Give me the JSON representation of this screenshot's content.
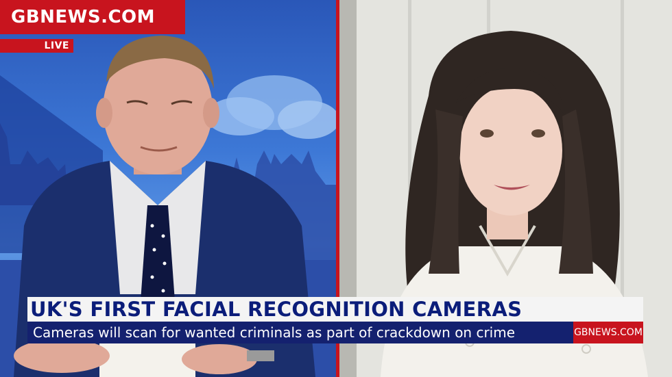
{
  "brand": {
    "name": "GBNEWS.COM",
    "color": "#c8141e"
  },
  "status": {
    "live_label": "LIVE"
  },
  "lower_third": {
    "headline": "UK'S FIRST FACIAL RECOGNITION CAMERAS",
    "ticker": "Cameras will scan for wanted criminals as part of crackdown on crime",
    "site_tag": "GBNEWS.COM",
    "headline_color": "#0b1d7a",
    "ticker_bg": "#14216f"
  },
  "scene": {
    "left_panel": "studio presenter",
    "right_panel": "remote guest"
  }
}
